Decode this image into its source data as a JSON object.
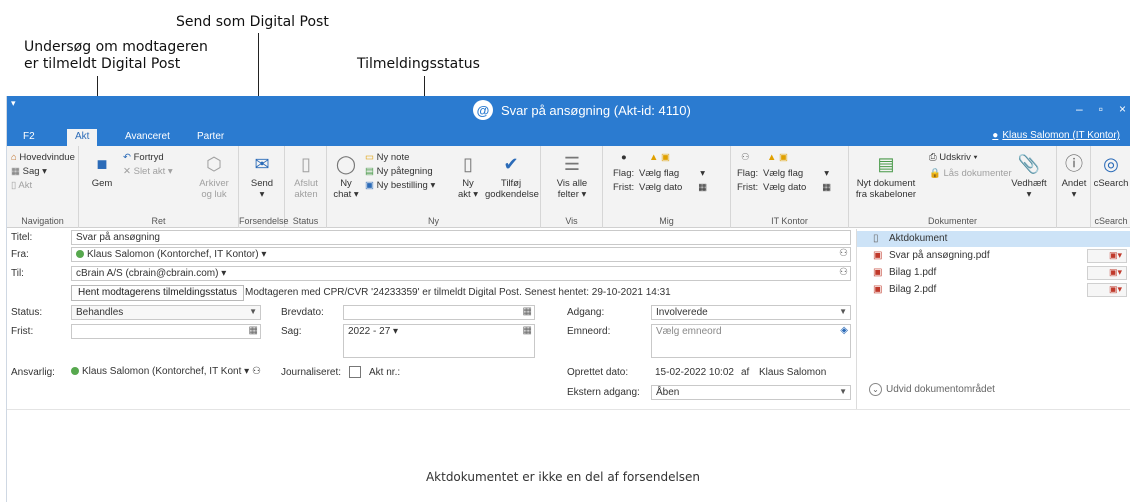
{
  "annotations": {
    "send_digital": "Send som Digital Post",
    "undersog_line1": "Undersøg om modtageren",
    "undersog_line2": "er tilmeldt Digital Post",
    "tilmeldingsstatus": "Tilmeldingsstatus"
  },
  "window": {
    "quick_access": "▾",
    "title": "Svar på ansøgning (Akt-id: 4110)",
    "controls": [
      "‒",
      "▫",
      "×"
    ]
  },
  "tabs": [
    "F2",
    "Akt",
    "Avanceret",
    "Parter"
  ],
  "user": "Klaus Salomon (IT Kontor)",
  "ribbon": {
    "navigation": {
      "label": "Navigation",
      "items": [
        "Hovedvindue",
        "Sag ▾",
        "Akt"
      ]
    },
    "ret": {
      "label": "Ret",
      "gem": "Gem",
      "fortryd": "Fortryd",
      "slet": "Slet akt ▾",
      "arkiver1": "Arkiver",
      "arkiver2": "og luk"
    },
    "forsendelse": {
      "label": "Forsendelse",
      "send": "Send",
      "send_arrow": "▾"
    },
    "status": {
      "label": "Status",
      "afslut1": "Afslut",
      "afslut2": "akten"
    },
    "ny": {
      "label": "Ny",
      "ny_chat1": "Ny",
      "ny_chat2": "chat ▾",
      "ny_note": "Ny note",
      "ny_paategning": "Ny påtegning",
      "ny_bestilling": "Ny bestilling ▾",
      "ny_akt1": "Ny",
      "ny_akt2": "akt ▾",
      "tilfoj1": "Tilføj",
      "tilfoj2": "godkendelse"
    },
    "vis": {
      "label": "Vis",
      "vis1": "Vis alle",
      "vis2": "felter ▾"
    },
    "mig": {
      "label": "Mig",
      "flag_label": "Flag:",
      "flag_value": "Vælg flag",
      "frist_label": "Frist:",
      "frist_value": "Vælg dato"
    },
    "itkontor": {
      "label": "IT Kontor",
      "flag_label": "Flag:",
      "flag_value": "Vælg flag",
      "frist_label": "Frist:",
      "frist_value": "Vælg dato"
    },
    "dokumenter": {
      "label": "Dokumenter",
      "nyt1": "Nyt dokument",
      "nyt2": "fra skabeloner",
      "udskriv": "Udskriv ▾",
      "laas": "Lås dokumenter",
      "vedhaeft": "Vedhæft",
      "andet": "Andet"
    },
    "csearch": {
      "label": "cSearch",
      "btn": "cSearch"
    }
  },
  "form": {
    "titel_label": "Titel:",
    "titel_value": "Svar på ansøgning",
    "fra_label": "Fra:",
    "fra_value": "Klaus Salomon (Kontorchef, IT Kontor) ▾",
    "til_label": "Til:",
    "til_value": "cBrain A/S (cbrain@cbrain.com) ▾",
    "hent_button": "Hent modtagerens tilmeldingsstatus",
    "status_text": "Modtageren med CPR/CVR '24233359' er tilmeldt Digital Post. Senest hentet: 29-10-2021 14:31",
    "status_label": "Status:",
    "status_value": "Behandles",
    "frist_label": "Frist:",
    "brevdato_label": "Brevdato:",
    "sag_label": "Sag:",
    "sag_value": "2022 - 27 ▾",
    "adgang_label": "Adgang:",
    "adgang_value": "Involverede",
    "emneord_label": "Emneord:",
    "emneord_placeholder": "Vælg emneord",
    "ansvarlig_label": "Ansvarlig:",
    "ansvarlig_value": "Klaus Salomon (Kontorchef, IT Kont ▾",
    "journaliseret_label": "Journaliseret:",
    "aktnr_label": "Akt nr.:",
    "oprettet_label": "Oprettet dato:",
    "oprettet_value": "15-02-2022 10:02",
    "af_label": "af",
    "af_value": "Klaus Salomon",
    "ekstern_label": "Ekstern adgang:",
    "ekstern_value": "Åben"
  },
  "documents": {
    "items": [
      "Aktdokument",
      "Svar på ansøgning.pdf",
      "Bilag 1.pdf",
      "Bilag 2.pdf"
    ],
    "udvid": "Udvid dokumentområdet"
  },
  "body_message": "Aktdokumentet er ikke en del af forsendelsen"
}
